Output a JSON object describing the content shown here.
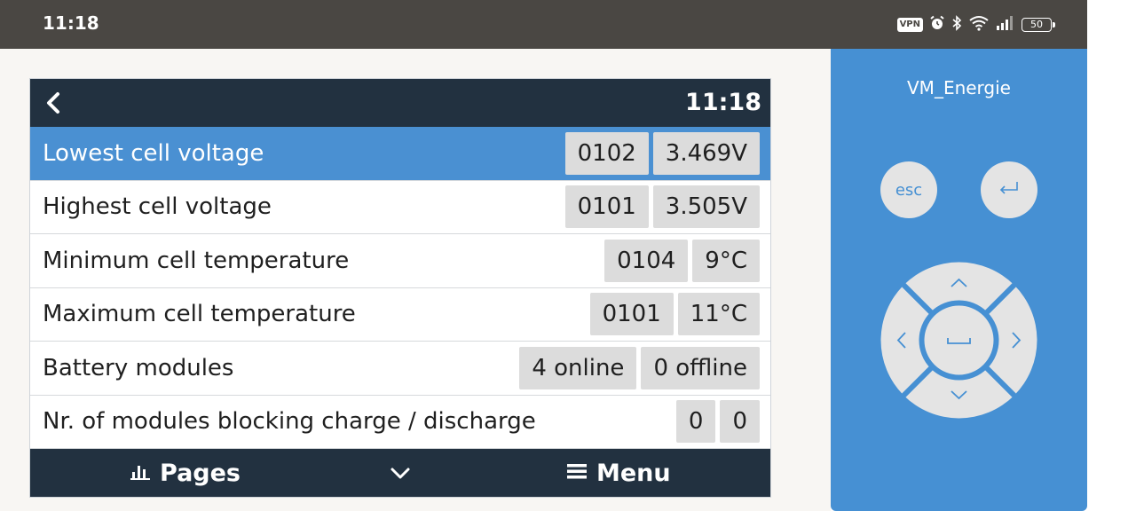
{
  "statusbar": {
    "time": "11:18",
    "vpn_label": "VPN",
    "battery_level": "50",
    "icons": [
      "vpn-icon",
      "alarm-icon",
      "bluetooth-icon",
      "wifi-icon",
      "signal-icon",
      "battery-icon"
    ]
  },
  "screen": {
    "header_time": "11:18",
    "rows": [
      {
        "label": "Lowest cell voltage",
        "values": [
          "0102",
          "3.469V"
        ],
        "selected": true
      },
      {
        "label": "Highest cell voltage",
        "values": [
          "0101",
          "3.505V"
        ]
      },
      {
        "label": "Minimum cell temperature",
        "values": [
          "0104",
          "9°C"
        ]
      },
      {
        "label": "Maximum cell temperature",
        "values": [
          "0101",
          "11°C"
        ]
      },
      {
        "label": "Battery modules",
        "values": [
          "4 online",
          "0 offline"
        ]
      },
      {
        "label": "Nr. of modules blocking charge / discharge",
        "values": [
          "0",
          "0"
        ]
      }
    ],
    "footer": {
      "pages_label": "Pages",
      "menu_label": "Menu"
    }
  },
  "control_panel": {
    "device_name": "VM_Energie",
    "esc_label": "esc"
  },
  "colors": {
    "header_bg": "#223140",
    "selected_row": "#4a90d2",
    "panel_blue": "#4690d3",
    "statusbar_bg": "#4a4743"
  }
}
